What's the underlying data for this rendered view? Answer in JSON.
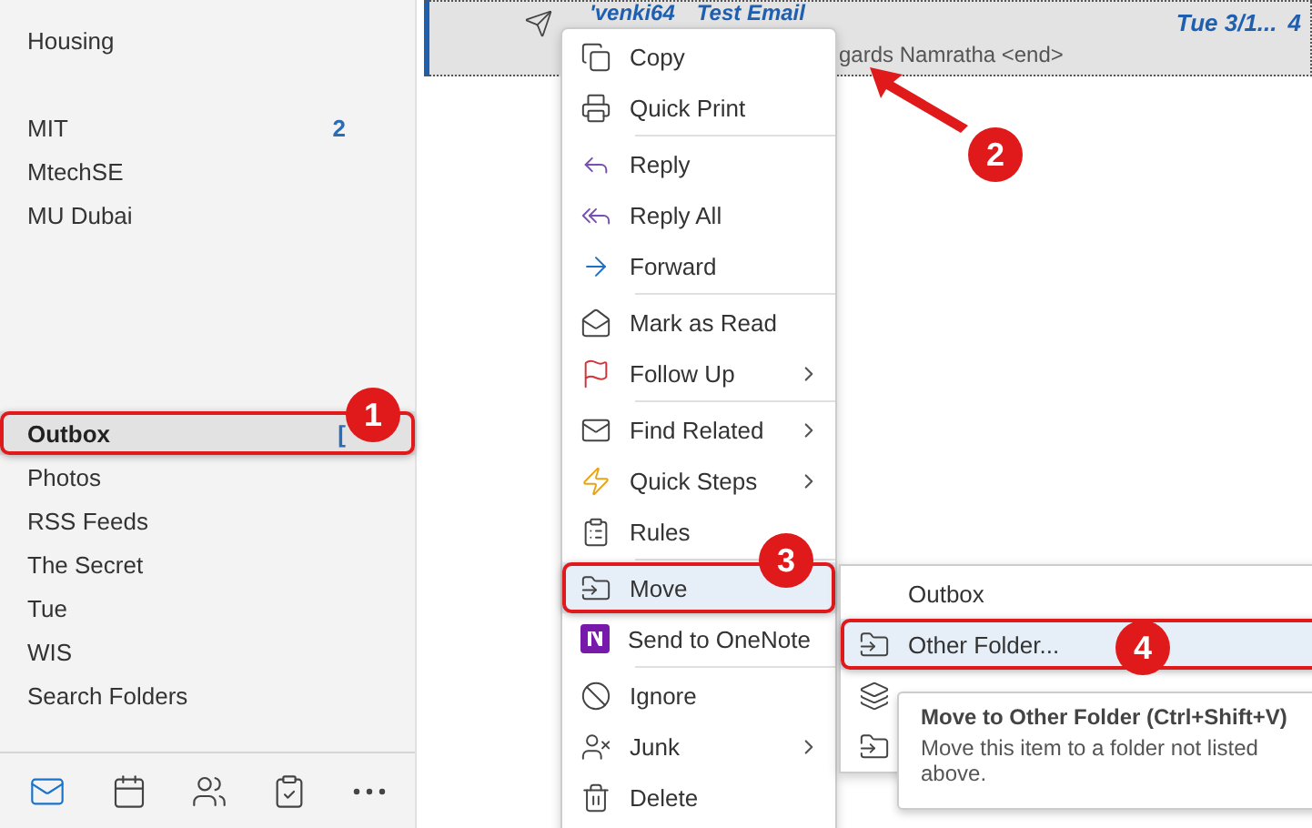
{
  "folder_groups": [
    [
      {
        "name": "Housing",
        "selected": false
      }
    ],
    [
      {
        "name": "MIT",
        "count": "2",
        "selected": false
      },
      {
        "name": "MtechSE",
        "selected": false
      },
      {
        "name": "MU Dubai",
        "selected": false
      }
    ],
    [
      {
        "name": "Outbox",
        "count": "[",
        "selected": true,
        "annotation": "1"
      },
      {
        "name": "Photos",
        "selected": false
      },
      {
        "name": "RSS Feeds",
        "selected": false
      },
      {
        "name": "The Secret",
        "selected": false
      },
      {
        "name": "Tue",
        "selected": false
      },
      {
        "name": "WIS",
        "selected": false
      },
      {
        "name": "Search Folders",
        "selected": false
      }
    ]
  ],
  "nav": [
    {
      "selected": true
    },
    {
      "selected": false
    },
    {
      "selected": false
    },
    {
      "selected": false
    },
    {
      "selected": false
    }
  ],
  "message": {
    "sender": "'venki64",
    "subject": "Test Email",
    "preview": "gards Namratha <end>",
    "date": "Tue 3/1...",
    "size": "4",
    "selected": true,
    "annotation": "2"
  },
  "context_menu": [
    {
      "label": "Copy",
      "selected": false
    },
    {
      "label": "Quick Print",
      "selected": false
    },
    {
      "kind": "separator"
    },
    {
      "label": "Reply",
      "selected": false
    },
    {
      "label": "Reply All",
      "selected": false
    },
    {
      "label": "Forward",
      "selected": false
    },
    {
      "kind": "separator"
    },
    {
      "label": "Mark as Read",
      "selected": false
    },
    {
      "label": "Follow Up",
      "submenu": true,
      "selected": false
    },
    {
      "kind": "separator"
    },
    {
      "label": "Find Related",
      "submenu": true,
      "selected": false
    },
    {
      "label": "Quick Steps",
      "submenu": true,
      "selected": false
    },
    {
      "label": "Rules",
      "selected": false
    },
    {
      "kind": "separator"
    },
    {
      "label": "Move",
      "selected": true,
      "annotation": "3"
    },
    {
      "label": "Send to OneNote",
      "selected": false
    },
    {
      "kind": "separator"
    },
    {
      "label": "Ignore",
      "selected": false
    },
    {
      "label": "Junk",
      "submenu": true,
      "selected": false
    },
    {
      "label": "Delete",
      "selected": false
    }
  ],
  "submenu": [
    {
      "label": "Outbox",
      "selected": false
    },
    {
      "label": "Other Folder...",
      "selected": true,
      "annotation": "4"
    },
    {
      "selected": false
    },
    {
      "selected": false
    }
  ],
  "tooltip": {
    "title": "Move to Other Folder (Ctrl+Shift+V)",
    "text": "Move this item to a folder not listed above."
  }
}
